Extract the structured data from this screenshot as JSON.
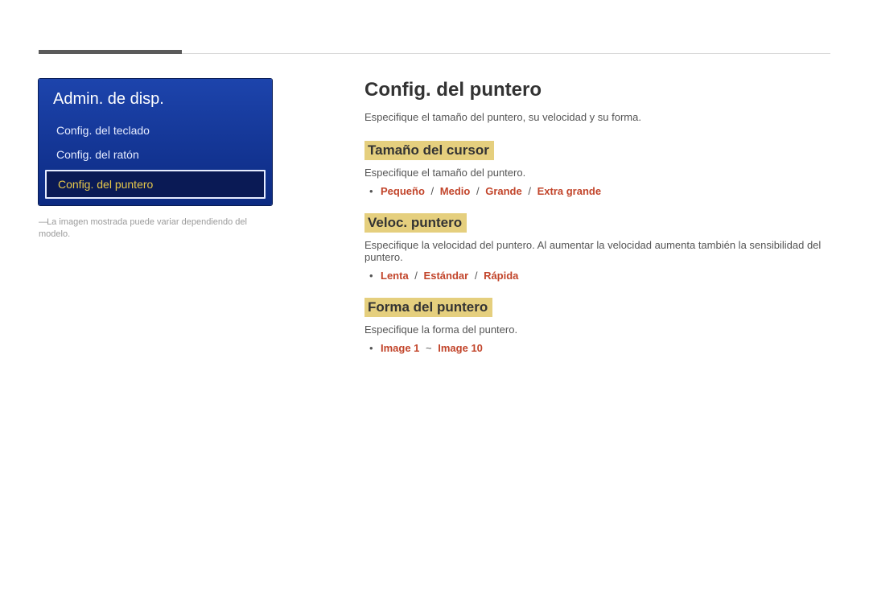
{
  "menu": {
    "title": "Admin. de disp.",
    "items": [
      {
        "label": "Config. del teclado",
        "active": false
      },
      {
        "label": "Config. del ratón",
        "active": false
      },
      {
        "label": "Config. del puntero",
        "active": true
      }
    ],
    "note": "La imagen mostrada puede variar dependiendo del modelo."
  },
  "content": {
    "title": "Config. del puntero",
    "lead": "Especifique el tamaño del puntero, su velocidad y su forma.",
    "sections": [
      {
        "heading": "Tamaño del cursor",
        "desc": "Especifique el tamaño del puntero.",
        "options": [
          "Pequeño",
          "Medio",
          "Grande",
          "Extra grande"
        ],
        "option_sep": "/"
      },
      {
        "heading": "Veloc. puntero",
        "desc": "Especifique la velocidad del puntero. Al aumentar la velocidad aumenta también la sensibilidad del puntero.",
        "options": [
          "Lenta",
          "Estándar",
          "Rápida"
        ],
        "option_sep": "/"
      },
      {
        "heading": "Forma del puntero",
        "desc": "Especifique la forma del puntero.",
        "options": [
          "Image 1",
          "Image 10"
        ],
        "option_sep": "~"
      }
    ]
  }
}
